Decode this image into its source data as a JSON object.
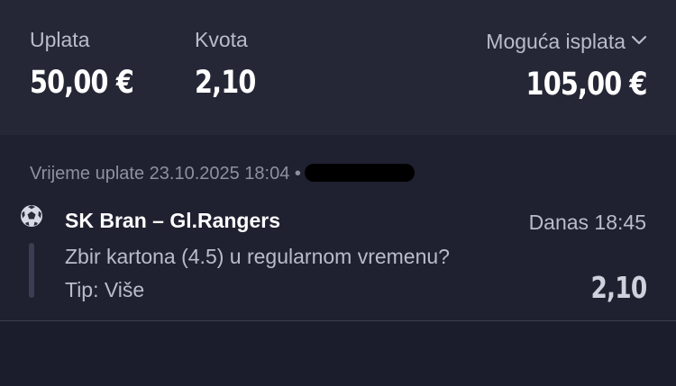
{
  "summary": {
    "stake_label": "Uplata",
    "stake_value": "50,00 €",
    "odds_label": "Kvota",
    "odds_value": "2,10",
    "payout_label": "Moguća isplata",
    "payout_value": "105,00 €",
    "payout_icon": "chevron-down-icon"
  },
  "ticket": {
    "paid_at": "Vrijeme uplate 23.10.2025 18:04 •",
    "selection": {
      "sport_icon": "soccer-ball-icon",
      "match": "SK Bran – Gl.Rangers",
      "time": "Danas 18:45",
      "market": "Zbir kartona (4.5) u regularnom vremenu?",
      "tip": "Tip: Više",
      "odds": "2,10"
    }
  },
  "colors": {
    "summary_bg": "#252736",
    "details_bg": "#1f2130",
    "page_bg": "#1b1d2c",
    "text_primary": "#ffffff",
    "text_secondary": "#b9bcc9",
    "text_muted": "#8d90a0"
  }
}
